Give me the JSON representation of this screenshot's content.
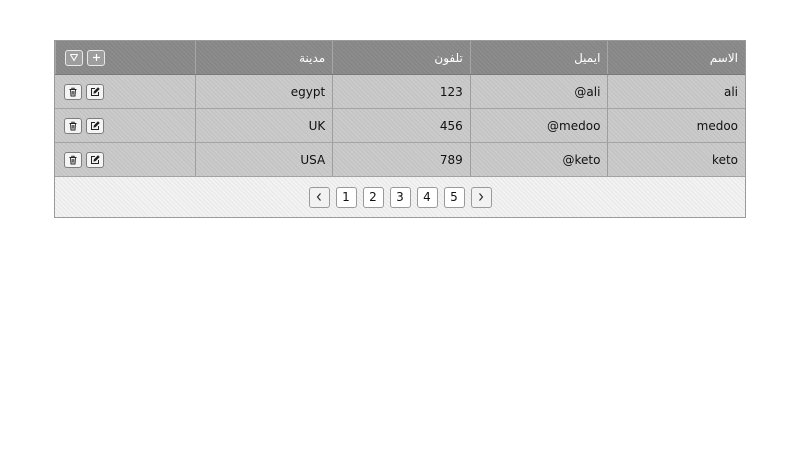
{
  "table": {
    "columns": [
      "الاسم",
      "ايميل",
      "تلفون",
      "مدينة"
    ],
    "header_buttons": {
      "add_icon": "plus-icon",
      "filter_icon": "filter-icon"
    },
    "row_buttons": {
      "edit_icon": "edit-icon",
      "delete_icon": "trash-icon"
    },
    "rows": [
      {
        "name": "ali",
        "email": "ali@",
        "phone": "123",
        "city": "egypt"
      },
      {
        "name": "medoo",
        "email": "medoo@",
        "phone": "456",
        "city": "UK"
      },
      {
        "name": "keto",
        "email": "keto@",
        "phone": "789",
        "city": "USA"
      }
    ]
  },
  "pager": {
    "prev_icon": "chevron-left-icon",
    "next_icon": "chevron-right-icon",
    "pages": [
      "1",
      "2",
      "3",
      "4",
      "5"
    ]
  },
  "colors": {
    "header_bg": "#8c8c8c",
    "row_bg": "#cbcbcb",
    "pager_bg": "#f3f3f3"
  }
}
